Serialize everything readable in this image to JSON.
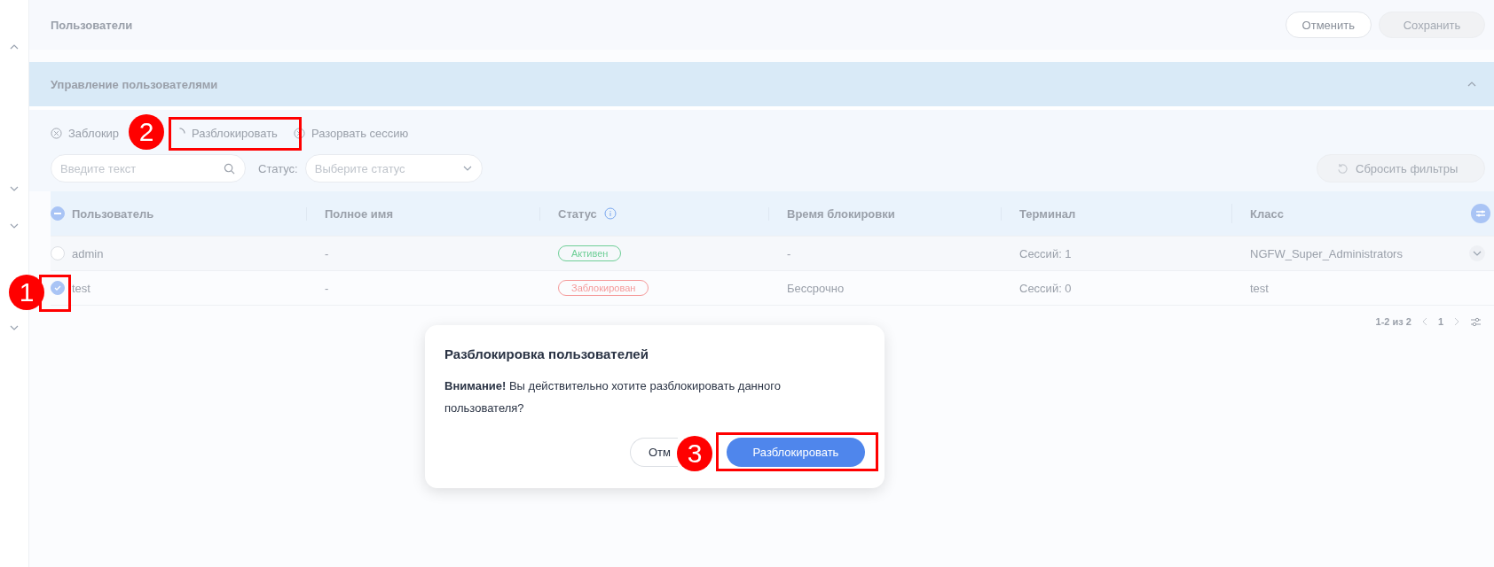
{
  "sidebar": {
    "items": [
      {
        "expanded": true
      },
      {
        "expanded": false
      },
      {
        "expanded": false
      },
      {
        "expanded": false
      }
    ]
  },
  "header": {
    "title": "Пользователи",
    "buttons": [
      {
        "label": "Отменить",
        "disabled": false
      },
      {
        "label": "Сохранить",
        "disabled": true
      }
    ]
  },
  "section": {
    "title": "Управление пользователями",
    "expanded": true
  },
  "actions": [
    {
      "label": "Заблокир",
      "kind": "close"
    },
    {
      "label": "Разблокировать",
      "kind": "loading"
    },
    {
      "label": "Разорвать сессию",
      "kind": "close"
    }
  ],
  "search": {
    "placeholder": "Введите текст"
  },
  "status_filter": {
    "label": "Статус:",
    "placeholder": "Выберите статус"
  },
  "reset_button": {
    "label": "Сбросить фильтры",
    "disabled": true
  },
  "table": {
    "select_all_partial": true,
    "columns": [
      {
        "label": "Пользователь",
        "info": false
      },
      {
        "label": "Полное имя",
        "info": false
      },
      {
        "label": "Статус",
        "info": true
      },
      {
        "label": "Время блокировки",
        "info": false
      },
      {
        "label": "Терминал",
        "info": false
      },
      {
        "label": "Класс",
        "info": false
      }
    ],
    "rows": [
      {
        "selected": false,
        "hovered": true,
        "user": "admin",
        "full_name": "-",
        "status": {
          "label": "Активен",
          "color": "#6fcf97"
        },
        "lock_time": "-",
        "terminal": "Сессий: 1",
        "class": "NGFW_Super_Administrators"
      },
      {
        "selected": true,
        "hovered": false,
        "user": "test",
        "full_name": "-",
        "status": {
          "label": "Заблокирован",
          "color": "#f59a9a"
        },
        "lock_time": "Бессрочно",
        "terminal": "Сессий: 0",
        "class": "test"
      }
    ]
  },
  "pagination": {
    "range": "1-2 из 2",
    "page": "1"
  },
  "dialog": {
    "title": "Разблокировка пользователей",
    "message": "**Внимание!** Вы действительно хотите разблокировать данного пользователя?",
    "buttons": [
      {
        "label": "Отм",
        "kind": "secondary"
      },
      {
        "label": "Разблокировать",
        "kind": "primary"
      }
    ]
  },
  "markers": [
    {
      "label": "1"
    },
    {
      "label": "2"
    },
    {
      "label": "3"
    }
  ]
}
